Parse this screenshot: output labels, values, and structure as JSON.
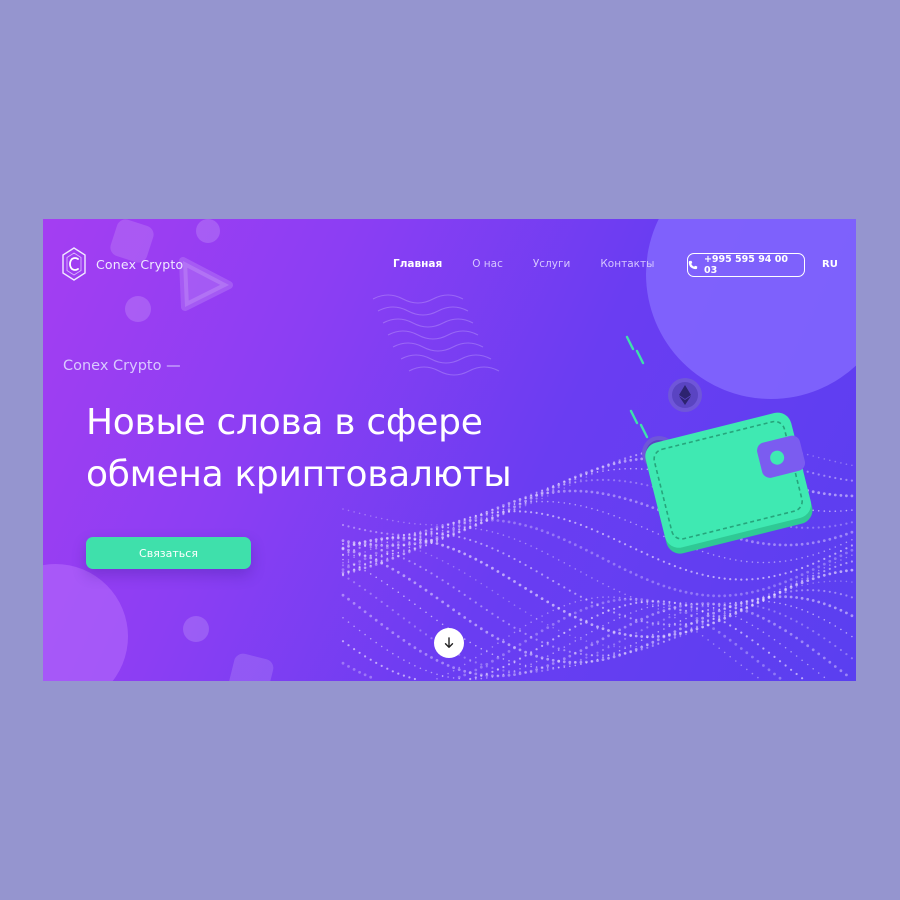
{
  "header": {
    "logo_text": "Conex Crypto",
    "nav": [
      {
        "label": "Главная",
        "active": true
      },
      {
        "label": "О нас",
        "active": false
      },
      {
        "label": "Услуги",
        "active": false
      },
      {
        "label": "Контакты",
        "active": false
      }
    ],
    "phone": "+995 595 94 00 03",
    "language": "RU"
  },
  "hero": {
    "eyebrow": "Conex Crypto —",
    "headline_line1": "Новые слова в сфере",
    "headline_line2": "обмена криптовалюты",
    "cta_label": "Связаться"
  },
  "icons": {
    "logo": "logo-c-hexagon-icon",
    "phone": "phone-icon",
    "scroll": "arrow-down-icon",
    "wallet": "wallet-illustration",
    "coin": "ethereum-coin-icon"
  },
  "colors": {
    "page_background": "#9595cf",
    "gradient_start": "#a43ef2",
    "gradient_end": "#5a3ff0",
    "accent_green": "#3fe0ab",
    "wallet_clasp": "#7b5cf0",
    "text_white": "#ffffff"
  }
}
